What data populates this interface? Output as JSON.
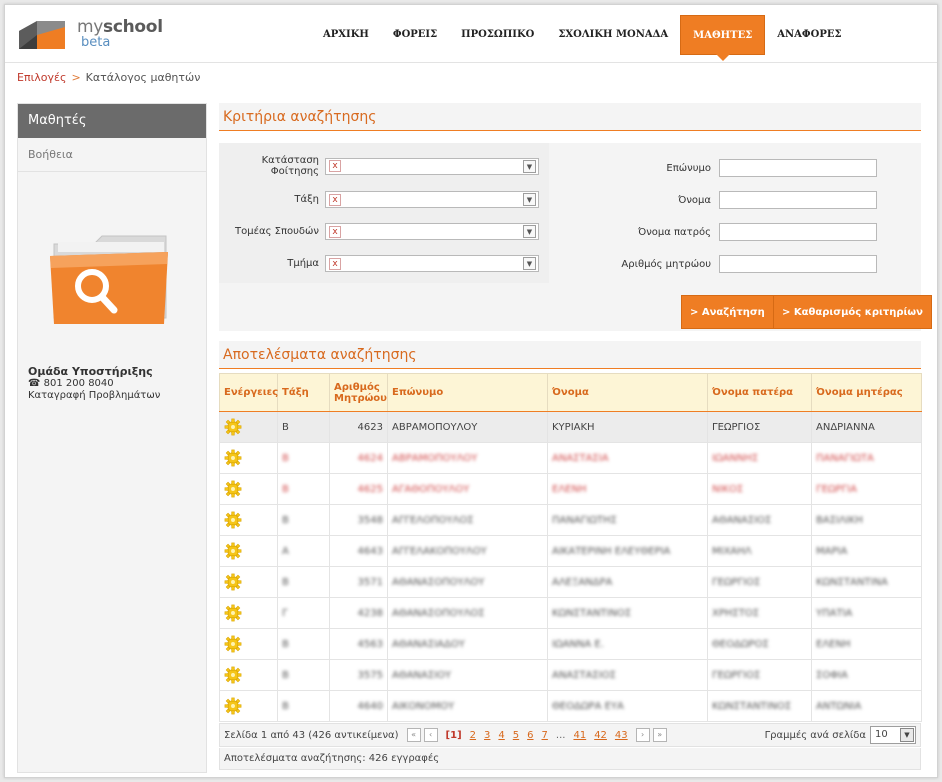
{
  "brand": {
    "name_light": "my",
    "name_bold": "school",
    "beta": "beta"
  },
  "nav": [
    "ΑΡΧΙΚΗ",
    "ΦΟΡΕΙΣ",
    "ΠΡΟΣΩΠΙΚΟ",
    "ΣΧΟΛΙΚΗ ΜΟΝΑΔΑ",
    "ΜΑΘΗΤΕΣ",
    "ΑΝΑΦΟΡΕΣ"
  ],
  "breadcrumb": {
    "link": "Επιλογές",
    "sep": ">",
    "current": "Κατάλογος μαθητών"
  },
  "sidebar": {
    "title": "Μαθητές",
    "help": "Βοήθεια",
    "support_title": "Ομάδα Υποστήριξης",
    "support_phone": "801 200 8040",
    "support_report": "Καταγραφή Προβλημάτων"
  },
  "criteria": {
    "title": "Κριτήρια αναζήτησης",
    "status_label_1": "Κατάσταση",
    "status_label_2": "Φοίτησης",
    "class_label": "Τάξη",
    "sector_label": "Τομέας Σπουδών",
    "section_label": "Τμήμα",
    "surname_label": "Επώνυμο",
    "name_label": "Όνομα",
    "father_label": "Όνομα πατρός",
    "reg_label": "Αριθμός μητρώου",
    "clear_x": "x",
    "search_button": "Αναζήτηση",
    "reset_button": "Καθαρισμός κριτηρίων",
    "button_prefix": ">"
  },
  "results": {
    "title": "Αποτελέσματα αναζήτησης",
    "headers": [
      "Ενέργειες",
      "Τάξη",
      "Αριθμός Μητρώου",
      "Επώνυμο",
      "Όνομα",
      "Όνομα πατέρα",
      "Όνομα μητέρας"
    ],
    "rows": [
      [
        "Β",
        "4623",
        "ΑΒΡΑΜΟΠΟΥΛΟΥ",
        "ΚΥΡΙΑΚΗ",
        "ΓΕΩΡΓΙΟΣ",
        "ΑΝΔΡΙΑΝΝΑ"
      ],
      [
        "Β",
        "4624",
        "ΑΒΡΑΜΟΠΟΥΛΟΥ",
        "ΑΝΑΣΤΑΣΙΑ",
        "ΙΩΑΝΝΗΣ",
        "ΠΑΝΑΓΙΩΤΑ"
      ],
      [
        "Β",
        "4625",
        "ΑΓΑΘΟΠΟΥΛΟΥ",
        "ΕΛΕΝΗ",
        "ΝΙΚΟΣ",
        "ΓΕΩΡΓΙΑ"
      ],
      [
        "Β",
        "3548",
        "ΑΓΓΕΛΟΠΟΥΛΟΣ",
        "ΠΑΝΑΓΙΩΤΗΣ",
        "ΑΘΑΝΑΣΙΟΣ",
        "ΒΑΣΙΛΙΚΗ"
      ],
      [
        "Α",
        "4643",
        "ΑΓΓΕΛΑΚΟΠΟΥΛΟΥ",
        "ΑΙΚΑΤΕΡΙΝΗ ΕΛΕΥΘΕΡΙΑ",
        "ΜΙΧΑΗΛ",
        "ΜΑΡΙΑ"
      ],
      [
        "Β",
        "3571",
        "ΑΘΑΝΑΣΟΠΟΥΛΟΥ",
        "ΑΛΕΞΑΝΔΡΑ",
        "ΓΕΩΡΓΙΟΣ",
        "ΚΩΝΣΤΑΝΤΙΝΑ"
      ],
      [
        "Γ",
        "4238",
        "ΑΘΑΝΑΣΟΠΟΥΛΟΣ",
        "ΚΩΝΣΤΑΝΤΙΝΟΣ",
        "ΧΡΗΣΤΟΣ",
        "ΥΠΑΤΙΑ"
      ],
      [
        "Β",
        "4563",
        "ΑΘΑΝΑΣΙΑΔΟΥ",
        "ΙΩΑΝΝΑ Ε.",
        "ΘΕΟΔΩΡΟΣ",
        "ΕΛΕΝΗ"
      ],
      [
        "Β",
        "3575",
        "ΑΘΑΝΑΣΙΟΥ",
        "ΑΝΑΣΤΑΣΙΟΣ",
        "ΓΕΩΡΓΙΟΣ",
        "ΣΟΦΙΑ"
      ],
      [
        "Β",
        "4640",
        "ΑΙΚΟΝΟΜΟΥ",
        "ΘΕΟΔΩΡΑ ΕΥΑ",
        "ΚΩΝΣΤΑΝΤΙΝΟΣ",
        "ΑΝΤΩΝΙΑ"
      ]
    ],
    "page_info": "Σελίδα 1 από 43 (426 αντικείμενα)",
    "pages": [
      "[1]",
      "2",
      "3",
      "4",
      "5",
      "6",
      "7",
      "...",
      "41",
      "42",
      "43"
    ],
    "first_label": "«",
    "prev_label": "‹",
    "next_label": "›",
    "last_label": "»",
    "per_page_label": "Γραμμές ανά σελίδα",
    "per_page_value": "10",
    "total": "Αποτελέσματα αναζήτησης: 426 εγγραφές"
  },
  "colors": {
    "accent": "#ef7d23",
    "header_text": "#d8691d",
    "link": "#c0392b"
  }
}
